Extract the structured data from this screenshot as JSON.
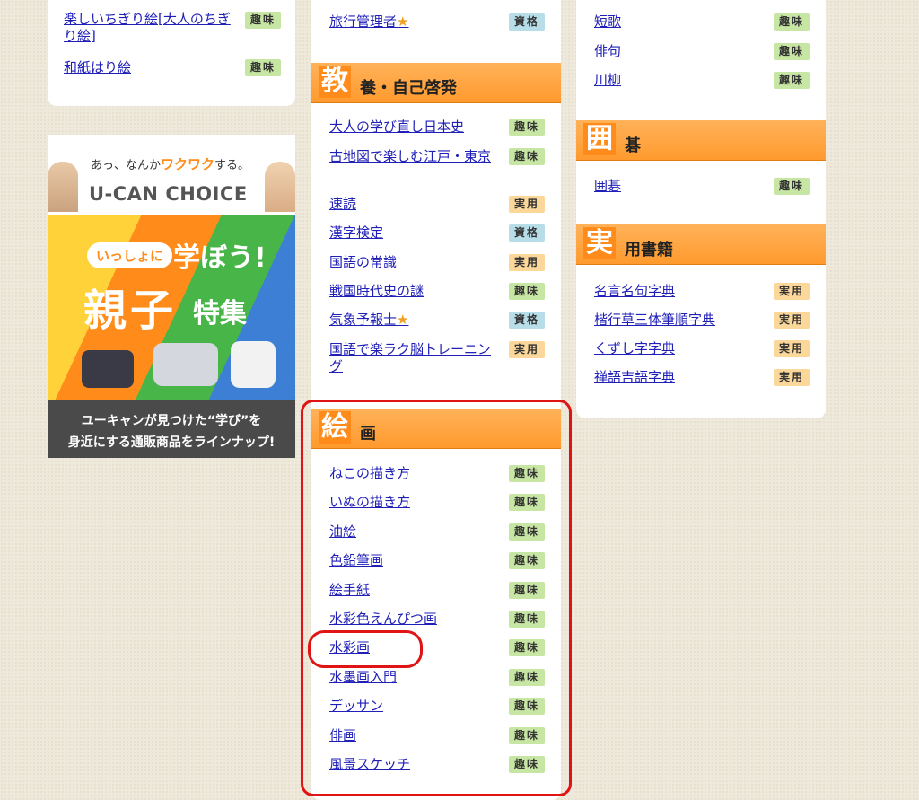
{
  "left_card": {
    "items": [
      {
        "label": "楽しいちぎり絵[大人のちぎり絵]",
        "badge": "趣味"
      },
      {
        "label": "和紙はり絵",
        "badge": "趣味"
      }
    ]
  },
  "ad": {
    "tagline_a": "あっ、なんか",
    "tagline_b": "ワクワク",
    "tagline_c": "する。",
    "brand": "U-CAN CHOICE",
    "pill": "いっしょに",
    "headline": "学ぼう!",
    "big": "親子",
    "tokushu": "特集",
    "footer_line1": "ユーキャンが見つけた“学び”を",
    "footer_line2": "身近にする通販商品をラインナップ!"
  },
  "middle_top": {
    "item": {
      "label": "旅行管理者",
      "badge": "資格",
      "star": "★"
    }
  },
  "kyoyo": {
    "big": "教",
    "rest": "養・自己啓発",
    "items": [
      {
        "label": "大人の学び直し日本史",
        "badge": "趣味"
      },
      {
        "label": "古地図で楽しむ江戸・東京",
        "badge": "趣味"
      },
      {
        "label": "速読",
        "badge": "実用"
      },
      {
        "label": "漢字検定",
        "badge": "資格"
      },
      {
        "label": "国語の常識",
        "badge": "実用"
      },
      {
        "label": "戦国時代史の謎",
        "badge": "趣味"
      },
      {
        "label": "気象予報士",
        "badge": "資格",
        "star": "★"
      },
      {
        "label": "国語で楽ラク脳トレーニング",
        "badge": "実用"
      }
    ]
  },
  "kaiga": {
    "big": "絵",
    "rest": "画",
    "items": [
      {
        "label": "ねこの描き方",
        "badge": "趣味"
      },
      {
        "label": "いぬの描き方",
        "badge": "趣味"
      },
      {
        "label": "油絵",
        "badge": "趣味"
      },
      {
        "label": "色鉛筆画",
        "badge": "趣味"
      },
      {
        "label": "絵手紙",
        "badge": "趣味"
      },
      {
        "label": "水彩色えんぴつ画",
        "badge": "趣味"
      },
      {
        "label": "水彩画",
        "badge": "趣味"
      },
      {
        "label": "水墨画入門",
        "badge": "趣味"
      },
      {
        "label": "デッサン",
        "badge": "趣味"
      },
      {
        "label": "俳画",
        "badge": "趣味"
      },
      {
        "label": "風景スケッチ",
        "badge": "趣味"
      }
    ]
  },
  "right_top": {
    "items": [
      {
        "label": "短歌",
        "badge": "趣味"
      },
      {
        "label": "俳句",
        "badge": "趣味"
      },
      {
        "label": "川柳",
        "badge": "趣味"
      }
    ]
  },
  "igo": {
    "big": "囲",
    "rest": "碁",
    "items": [
      {
        "label": "囲碁",
        "badge": "趣味"
      }
    ]
  },
  "jitsuyo": {
    "big": "実",
    "rest": "用書籍",
    "items": [
      {
        "label": "名言名句字典",
        "badge": "実用"
      },
      {
        "label": "楷行草三体筆順字典",
        "badge": "実用"
      },
      {
        "label": "くずし字字典",
        "badge": "実用"
      },
      {
        "label": "禅語吉語字典",
        "badge": "実用"
      }
    ]
  },
  "colors": {
    "category_orange": "#ff9a2e",
    "highlight_red": "#e01414",
    "link_blue": "#2020b8"
  }
}
